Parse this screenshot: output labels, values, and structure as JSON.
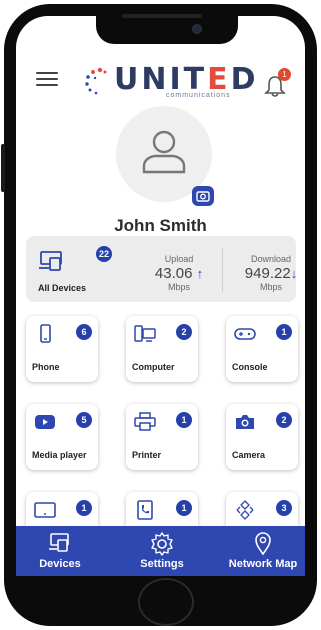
{
  "header": {
    "logo_text_left": "U",
    "logo_text_mid": "NIT",
    "logo_text_red": "E",
    "logo_text_right": "D",
    "logo_subtitle": "communications",
    "notification_count": "1"
  },
  "profile": {
    "name": "John Smith"
  },
  "summary": {
    "all_devices_label": "All Devices",
    "all_devices_count": "22",
    "upload_label": "Upload",
    "upload_value": "43.06",
    "upload_unit": "Mbps",
    "download_label": "Download",
    "download_value": "949.22",
    "download_unit": "Mbps"
  },
  "devices": [
    {
      "label": "Phone",
      "count": "6",
      "icon": "phone-icon"
    },
    {
      "label": "Computer",
      "count": "2",
      "icon": "computer-icon"
    },
    {
      "label": "Console",
      "count": "1",
      "icon": "gamepad-icon"
    },
    {
      "label": "Media player",
      "count": "5",
      "icon": "play-icon"
    },
    {
      "label": "Printer",
      "count": "1",
      "icon": "printer-icon"
    },
    {
      "label": "Camera",
      "count": "2",
      "icon": "camera-icon"
    },
    {
      "label": "",
      "count": "1",
      "icon": "tablet-icon"
    },
    {
      "label": "",
      "count": "1",
      "icon": "voip-phone-icon"
    },
    {
      "label": "",
      "count": "3",
      "icon": "router-icon"
    }
  ],
  "tabs": [
    {
      "label": "Devices",
      "icon": "devices-icon"
    },
    {
      "label": "Settings",
      "icon": "gear-icon"
    },
    {
      "label": "Network Map",
      "icon": "map-pin-icon"
    }
  ],
  "colors": {
    "brand_blue": "#2f47b0",
    "badge_blue": "#2540a8",
    "logo_navy": "#2e3b62",
    "logo_red": "#e34b3d",
    "notification_red": "#e24a2f"
  }
}
